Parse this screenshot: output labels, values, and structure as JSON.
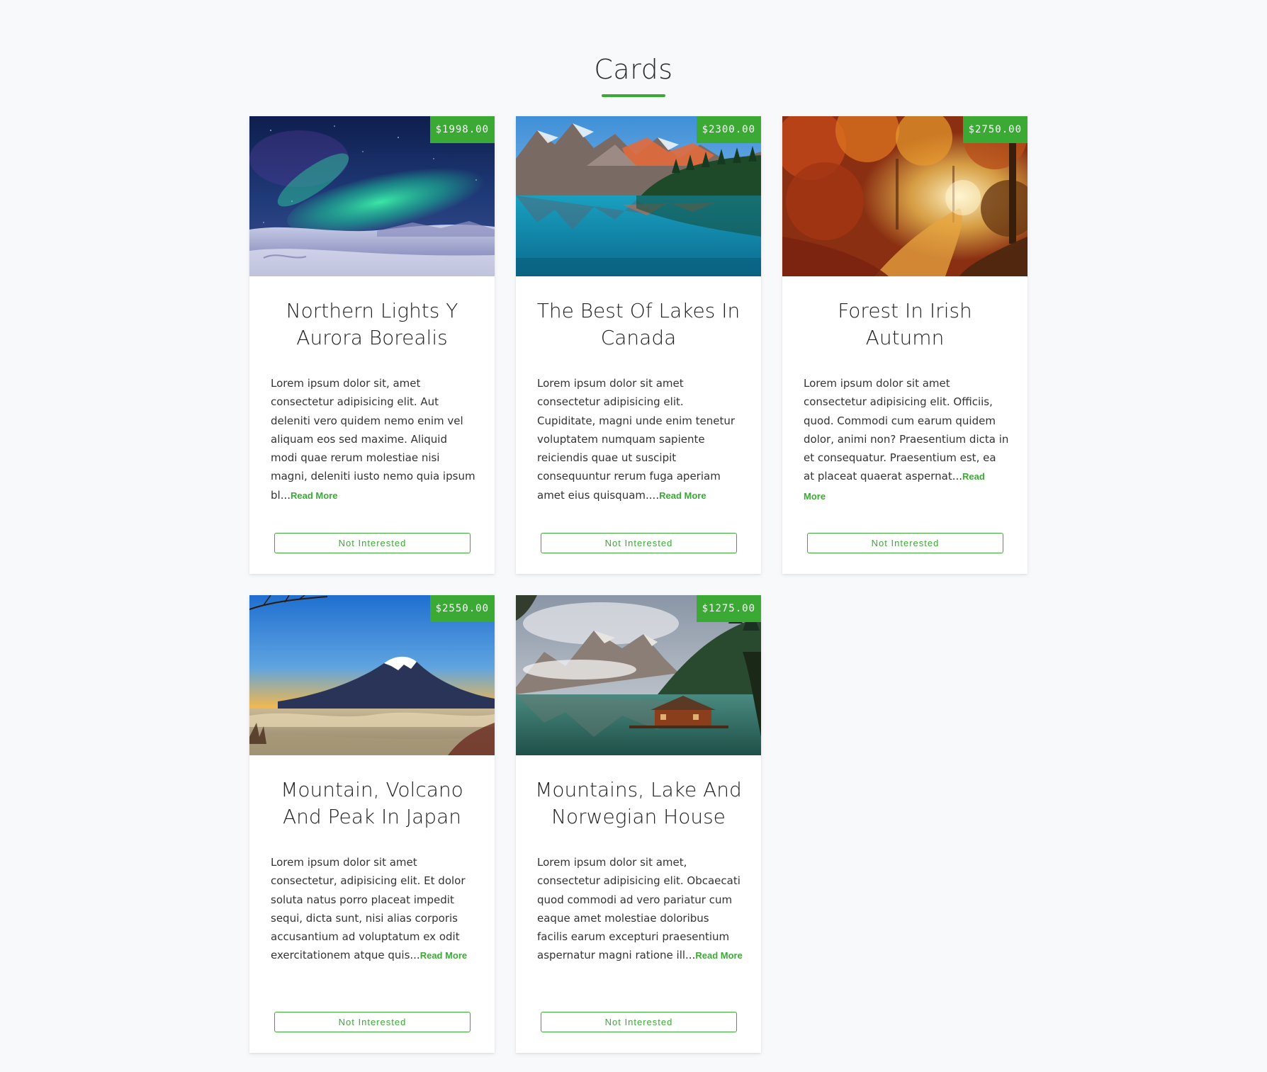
{
  "page": {
    "title": "Cards",
    "accent_color": "#3aaa35"
  },
  "cards": [
    {
      "price": "$1998.00",
      "title": "Northern Lights Y Aurora Borealis",
      "text": "Lorem ipsum dolor sit, amet consectetur adipisicing elit. Aut deleniti vero quidem nemo enim vel aliquam eos sed maxime. Aliquid modi quae rerum molestiae nisi magni, deleniti iusto nemo quia ipsum bl...",
      "read_more": "Read More",
      "button": "Not Interested",
      "image": "aurora-snow-landscape"
    },
    {
      "price": "$2300.00",
      "title": "The Best Of Lakes In Canada",
      "text": "Lorem ipsum dolor sit amet consectetur adipisicing elit. Cupiditate, magni unde enim tenetur voluptatem numquam sapiente reiciendis quae ut suscipit consequuntur rerum fuga aperiam amet eius quisquam....",
      "read_more": "Read More",
      "button": "Not Interested",
      "image": "mountain-lake"
    },
    {
      "price": "$2750.00",
      "title": "Forest In Irish Autumn",
      "text": "Lorem ipsum dolor sit amet consectetur adipisicing elit. Officiis, quod. Commodi cum earum quidem dolor, animi non? Praesentium dicta in et consequatur. Praesentium est, ea at placeat quaerat aspernat...",
      "read_more": "Read More",
      "button": "Not Interested",
      "image": "autumn-forest-path"
    },
    {
      "price": "$2550.00",
      "title": "Mountain, Volcano And Peak In Japan",
      "text": "Lorem ipsum dolor sit amet consectetur, adipisicing elit. Et dolor soluta natus porro placeat impedit sequi, dicta sunt, nisi alias corporis accusantium ad voluptatum ex odit exercitationem atque quis...",
      "read_more": "Read More",
      "button": "Not Interested",
      "image": "volcano-sunrise"
    },
    {
      "price": "$1275.00",
      "title": "Mountains, Lake And Norwegian House",
      "text": "Lorem ipsum dolor sit amet, consectetur adipisicing elit. Obcaecati quod commodi ad vero pariatur cum eaque amet molestiae doloribus facilis earum excepturi praesentium aspernatur magni ratione ill...",
      "read_more": "Read More",
      "button": "Not Interested",
      "image": "lake-house-mountains"
    }
  ]
}
